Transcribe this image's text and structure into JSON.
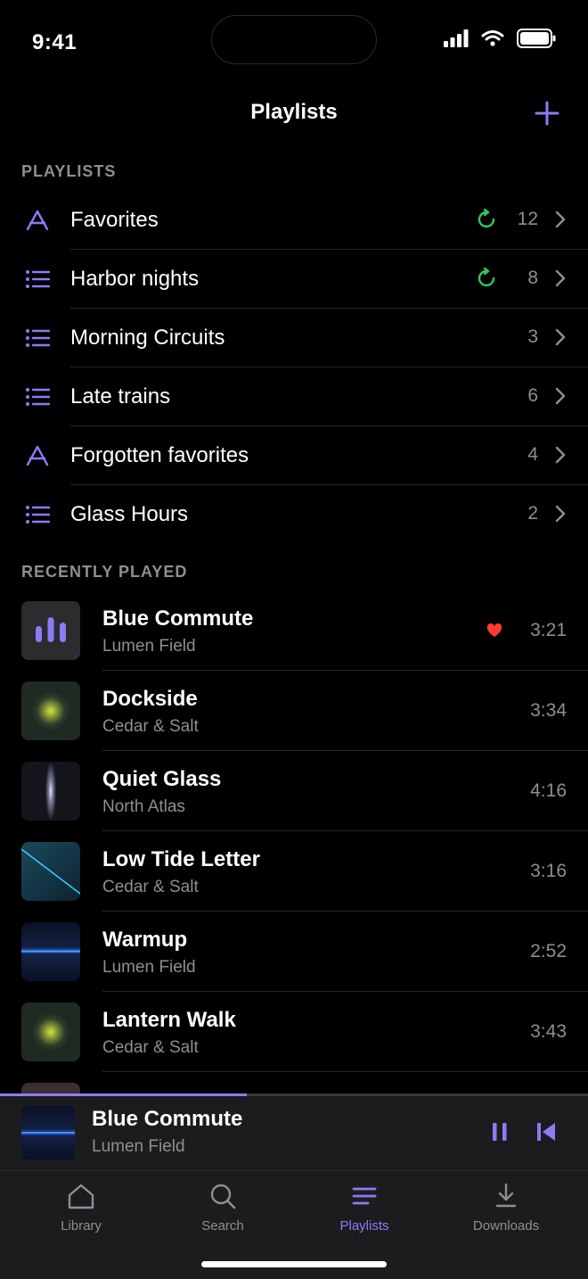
{
  "status_bar": {
    "time": "9:41"
  },
  "nav": {
    "title": "Playlists"
  },
  "sections": {
    "playlists": "PLAYLISTS",
    "recently_played": "RECENTLY PLAYED"
  },
  "colors": {
    "accent": "#8b7cf6",
    "sync": "#34c759",
    "heart": "#ff3b30",
    "secondary_text": "#8e8e93"
  },
  "playlists": [
    {
      "name": "Favorites",
      "count": "12",
      "icon": "smart-playlist-icon",
      "synced": true
    },
    {
      "name": "Harbor nights",
      "count": "8",
      "icon": "list-icon",
      "synced": true
    },
    {
      "name": "Morning Circuits",
      "count": "3",
      "icon": "list-icon",
      "synced": false
    },
    {
      "name": "Late trains",
      "count": "6",
      "icon": "list-icon",
      "synced": false
    },
    {
      "name": "Forgotten favorites",
      "count": "4",
      "icon": "smart-playlist-icon",
      "synced": false
    },
    {
      "name": "Glass Hours",
      "count": "2",
      "icon": "list-icon",
      "synced": false
    }
  ],
  "recently_played": [
    {
      "title": "Blue Commute",
      "artist": "Lumen Field",
      "duration": "3:21",
      "liked": true,
      "art": "bars"
    },
    {
      "title": "Dockside",
      "artist": "Cedar & Salt",
      "duration": "3:34",
      "liked": false,
      "art": "burst"
    },
    {
      "title": "Quiet Glass",
      "artist": "North Atlas",
      "duration": "4:16",
      "liked": false,
      "art": "sliver"
    },
    {
      "title": "Low Tide Letter",
      "artist": "Cedar & Salt",
      "duration": "3:16",
      "liked": false,
      "art": "diagonal"
    },
    {
      "title": "Warmup",
      "artist": "Lumen Field",
      "duration": "2:52",
      "liked": false,
      "art": "horizon"
    },
    {
      "title": "Lantern Walk",
      "artist": "Cedar & Salt",
      "duration": "3:43",
      "liked": false,
      "art": "burst"
    },
    {
      "title": "",
      "artist": "",
      "duration": "",
      "liked": false,
      "art": "partial"
    }
  ],
  "mini_player": {
    "title": "Blue Commute",
    "artist": "Lumen Field",
    "progress": 0.42
  },
  "tabs": [
    {
      "label": "Library",
      "icon": "library-icon",
      "active": false
    },
    {
      "label": "Search",
      "icon": "search-icon",
      "active": false
    },
    {
      "label": "Playlists",
      "icon": "playlists-icon",
      "active": true
    },
    {
      "label": "Downloads",
      "icon": "downloads-icon",
      "active": false
    }
  ]
}
